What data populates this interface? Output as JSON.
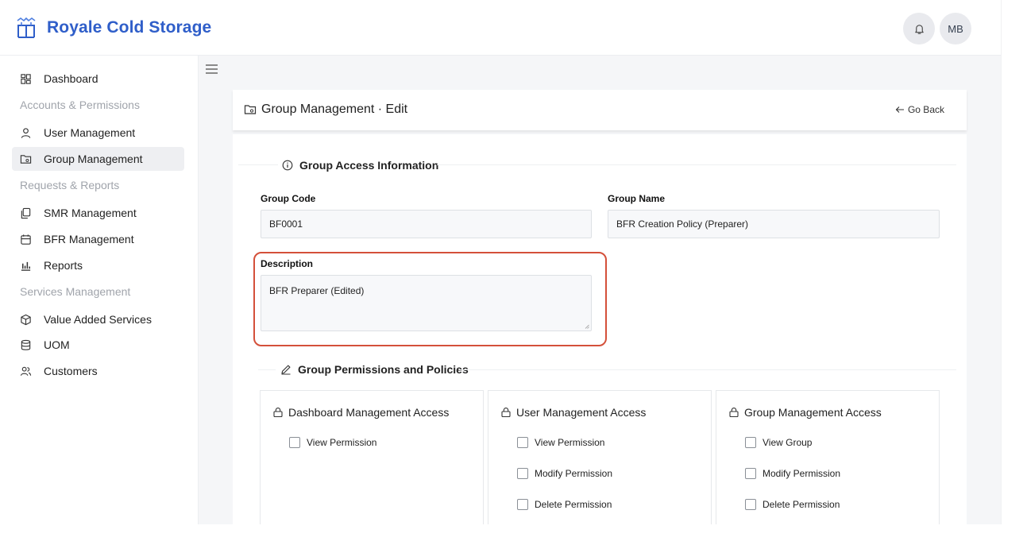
{
  "header": {
    "brand": "Royale Cold Storage",
    "avatar_initials": "MB",
    "icons": [
      "bell-icon",
      "logo-icon"
    ]
  },
  "sidebar": {
    "items": [
      {
        "label": "Dashboard",
        "icon": "grid-icon"
      },
      {
        "label": "User Management",
        "icon": "user-icon"
      },
      {
        "label": "Group Management",
        "icon": "folder-icon",
        "active": true
      },
      {
        "label": "SMR Management",
        "icon": "copy-icon"
      },
      {
        "label": "BFR Management",
        "icon": "calendar-icon"
      },
      {
        "label": "Reports",
        "icon": "bar-chart-icon"
      },
      {
        "label": "Value Added Services",
        "icon": "box-icon"
      },
      {
        "label": "UOM",
        "icon": "database-icon"
      },
      {
        "label": "Customers",
        "icon": "users-icon"
      }
    ],
    "sections": [
      "Accounts & Permissions",
      "Requests & Reports",
      "Services Management"
    ]
  },
  "page": {
    "title": "Group Management · Edit",
    "go_back": "Go Back"
  },
  "access_info": {
    "heading": "Group Access Information",
    "group_code_label": "Group Code",
    "group_code_value": "BF0001",
    "group_name_label": "Group Name",
    "group_name_value": "BFR Creation Policy (Preparer)",
    "description_label": "Description",
    "description_value": "BFR Preparer (Edited)"
  },
  "permissions": {
    "heading": "Group Permissions and Policies",
    "boxes": [
      {
        "title": "Dashboard Management Access",
        "options": [
          "View Permission"
        ]
      },
      {
        "title": "User Management Access",
        "options": [
          "View Permission",
          "Modify Permission",
          "Delete Permission"
        ]
      },
      {
        "title": "Group Management Access",
        "options": [
          "View Group",
          "Modify Permission",
          "Delete Permission"
        ]
      }
    ]
  },
  "colors": {
    "brand": "#2f5ec9",
    "highlight": "#d4503a"
  }
}
